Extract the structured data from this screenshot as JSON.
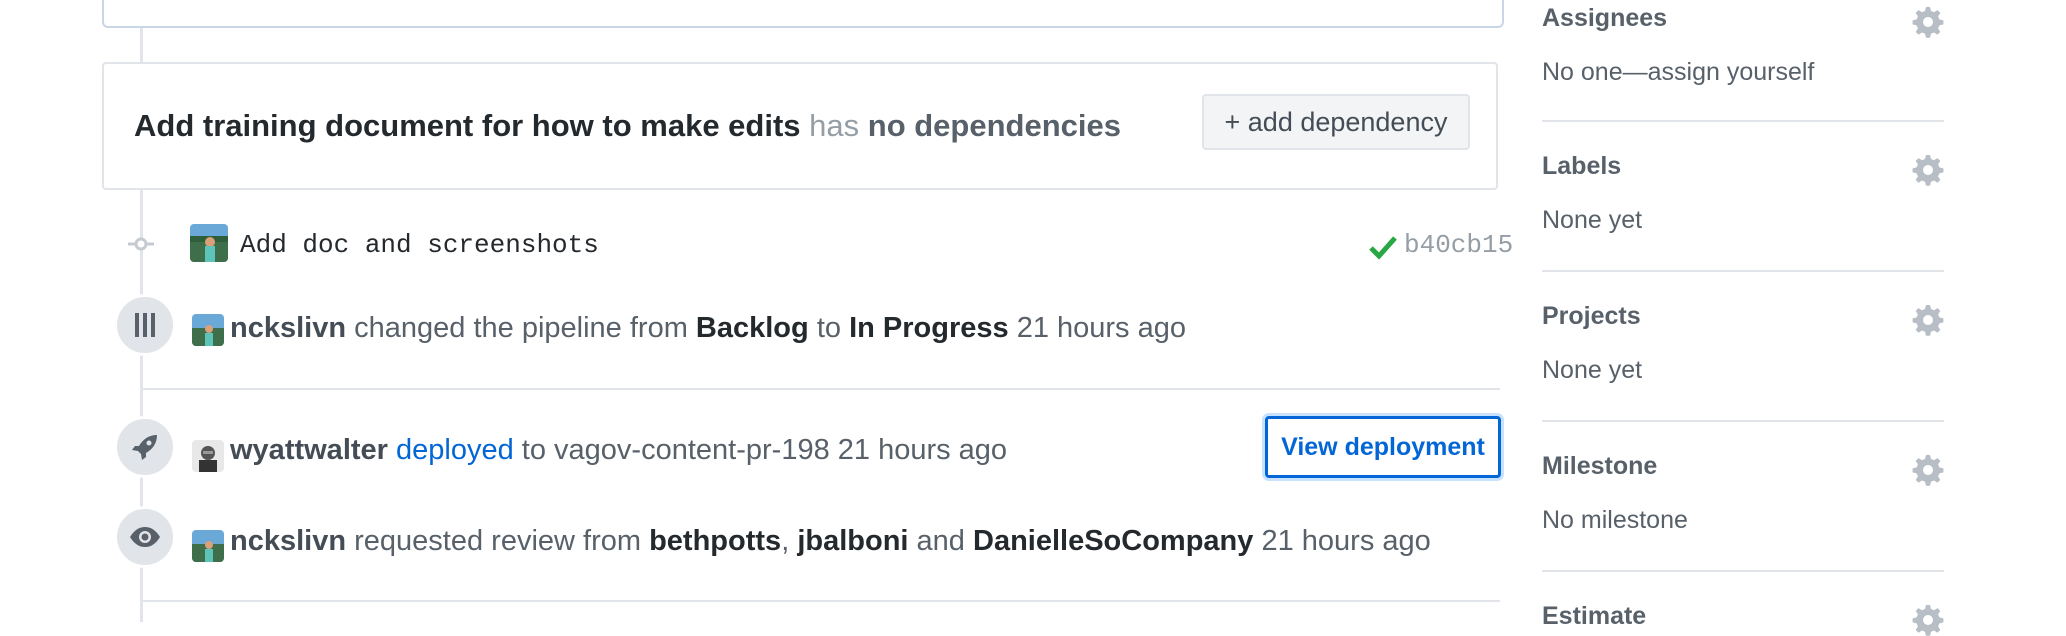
{
  "dependency_card": {
    "title": "Add training document for how to make edits",
    "has_text": "has",
    "status": "no dependencies",
    "add_button": "+ add dependency"
  },
  "commit": {
    "message": "Add doc and screenshots",
    "sha": "b40cb15",
    "status_icon": "check-icon",
    "status_color": "#28a745"
  },
  "pipeline_event": {
    "user": "nckslivn",
    "text_changed": "changed the pipeline from",
    "from": "Backlog",
    "to_word": "to",
    "to": "In Progress",
    "time": "21 hours ago",
    "icon": "pipeline-icon"
  },
  "deploy_event": {
    "user": "wyattwalter",
    "action": "deployed",
    "to_word": "to",
    "target": "vagov-content-pr-198",
    "time": "21 hours ago",
    "button": "View deployment",
    "icon": "rocket-icon"
  },
  "review_event": {
    "user": "nckslivn",
    "text": "requested review from",
    "reviewer1": "bethpotts",
    "comma": ",",
    "reviewer2": "jbalboni",
    "and_word": "and",
    "reviewer3": "DanielleSoCompany",
    "time": "21 hours ago",
    "icon": "eye-icon"
  },
  "sidebar": {
    "assignees": {
      "title": "Assignees",
      "value": "No one—assign yourself"
    },
    "labels": {
      "title": "Labels",
      "value": "None yet"
    },
    "projects": {
      "title": "Projects",
      "value": "None yet"
    },
    "milestone": {
      "title": "Milestone",
      "value": "No milestone"
    },
    "estimate": {
      "title": "Estimate"
    }
  },
  "colors": {
    "link": "#0366d6",
    "muted": "#586069",
    "border": "#e1e4e8"
  }
}
